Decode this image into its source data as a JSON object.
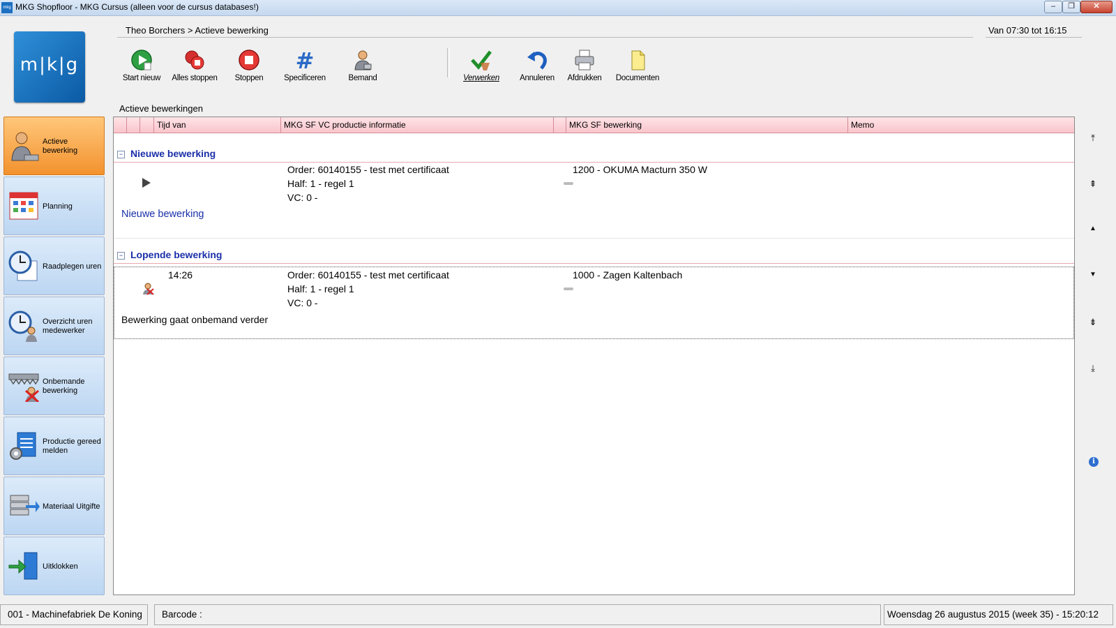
{
  "window": {
    "title": "MKG Shopfloor - MKG Cursus (alleen voor de cursus databases!)",
    "app_icon_text": "mkg"
  },
  "logo": {
    "text": "m|k|g"
  },
  "header": {
    "breadcrumb": "Theo Borchers > Actieve bewerking",
    "shift": "Van 07:30 tot 16:15"
  },
  "toolbar": {
    "start_nieuw": "Start nieuw",
    "alles_stoppen": "Alles stoppen",
    "stoppen": "Stoppen",
    "specificeren": "Specificeren",
    "bemand": "Bemand",
    "verwerken": "Verwerken",
    "annuleren": "Annuleren",
    "afdrukken": "Afdrukken",
    "documenten": "Documenten"
  },
  "sidebar": {
    "items": [
      {
        "label": "Actieve bewerking"
      },
      {
        "label": "Planning"
      },
      {
        "label": "Raadplegen uren"
      },
      {
        "label": "Overzicht uren medewerker"
      },
      {
        "label": "Onbemande bewerking"
      },
      {
        "label": "Productie gereed melden"
      },
      {
        "label": "Materiaal Uitgifte"
      },
      {
        "label": "Uitklokken"
      }
    ]
  },
  "main": {
    "section_title": "Actieve bewerkingen",
    "columns": [
      "Tijd van",
      "MKG SF VC productie informatie",
      "MKG SF bewerking",
      "Memo"
    ],
    "groups": [
      {
        "title": "Nieuwe bewerking",
        "row": {
          "time": "",
          "order": "Order: 60140155 - test met certificaat",
          "half": "Half: 1 - regel 1",
          "vc": "VC: 0 -",
          "operation": "1200 - OKUMA Macturn 350 W",
          "note": "Nieuwe bewerking"
        }
      },
      {
        "title": "Lopende bewerking",
        "row": {
          "time": "14:26",
          "order": "Order: 60140155 - test met certificaat",
          "half": "Half: 1 - regel 1",
          "vc": "VC: 0 -",
          "operation": "1000 - Zagen Kaltenbach",
          "note": "Bewerking gaat onbemand verder"
        }
      }
    ]
  },
  "statusbar": {
    "company": "001 - Machinefabriek De Koning",
    "barcode_label": "Barcode :",
    "datetime": "Woensdag 26 augustus 2015 (week 35)  - 15:20:12"
  },
  "colors": {
    "accent_blue": "#1a2fa8",
    "sidebar_active": "#f3922e",
    "header_pink": "#f9c6cc"
  }
}
